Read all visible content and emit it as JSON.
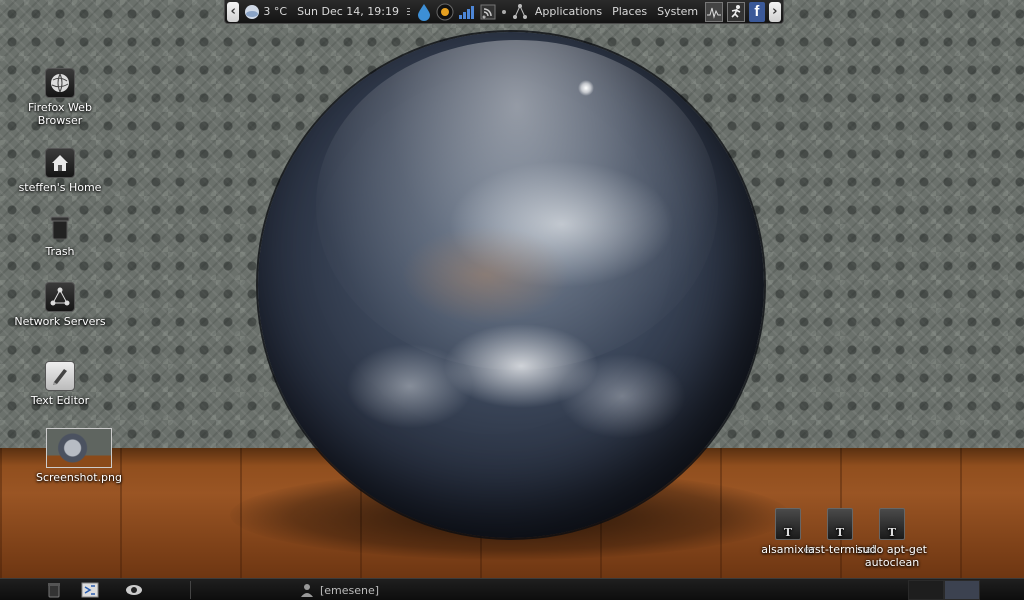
{
  "top_panel": {
    "left_arrow": "‹",
    "right_arrow": "›",
    "weather": "3 °C",
    "clock": "Sun Dec 14, 19:19",
    "menus": [
      "Applications",
      "Places",
      "System"
    ]
  },
  "desktop_icons": [
    {
      "label": "Firefox Web Browser"
    },
    {
      "label": "steffen's Home"
    },
    {
      "label": "Trash"
    },
    {
      "label": "Network Servers"
    },
    {
      "label": "Text Editor"
    },
    {
      "label": "Screenshot.png"
    }
  ],
  "launchers": [
    {
      "label": "alsamixer",
      "glyph": "T"
    },
    {
      "label": "last-terminal",
      "glyph": "T"
    },
    {
      "label": "sudo apt-get autoclean",
      "glyph": "T"
    }
  ],
  "bottom_panel": {
    "task_label": "[emesene]"
  },
  "colors": {
    "panel_bg": "#1a1a1a",
    "facebook_blue": "#3b5998",
    "water_blue": "#3d8fd6"
  }
}
